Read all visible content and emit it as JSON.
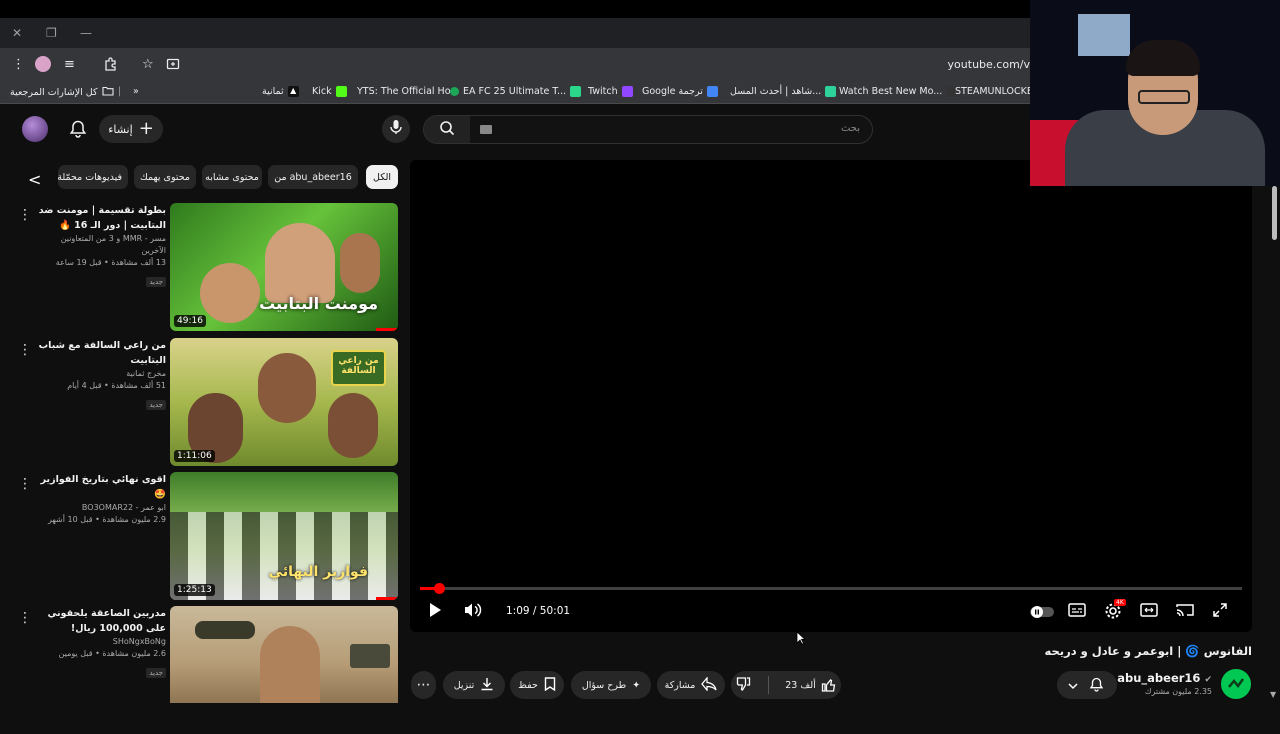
{
  "browser": {
    "url": "youtube.com/v",
    "bookmarks_all_label": "كل الإشارات المرجعية",
    "bookmarks": [
      {
        "label": "ثمانية",
        "color": "#000000"
      },
      {
        "label": "Kick",
        "color": "#53fc18"
      },
      {
        "label": "YTS: The Official Ho...",
        "color": "#444444"
      },
      {
        "label": "EA FC 25 Ultimate T...",
        "color": "#1ca858"
      },
      {
        "label": "Twitch",
        "color": "#9146ff"
      },
      {
        "label": "Google ترجمة",
        "color": "#4285f4"
      },
      {
        "label": "شاهد | أحدث المسل...",
        "color": "#2ed39c"
      },
      {
        "label": "Watch Best New Mo...",
        "color": "#333333"
      },
      {
        "label": "STEAMUNLOCKED",
        "color": "#666666"
      }
    ]
  },
  "header": {
    "create_label": "إنشاء",
    "search_placeholder": "بحث"
  },
  "chips": [
    "الكل",
    "من abu_abeer16",
    "محتوى مشابه",
    "محتوى يهمك",
    "فيديوهات محمّلة مؤخرًا"
  ],
  "recommendations": [
    {
      "title": "بطولة تقسيمة | مومنت ضد البتابيت | دور الـ 16 🔥",
      "channel": "مسر - MMR و 3 من المتعاونين الآخرين",
      "stats": "13 ألف مشاهدة • قبل 19 ساعة",
      "badge": "جديد",
      "duration": "49:16",
      "thumb_text": "مومنت البتابيت"
    },
    {
      "title": "من راعي السالفة مع شباب البتابيت",
      "channel": "مخرج ثمانية",
      "stats": "51 ألف مشاهدة • قبل 4 أيام",
      "badge": "جديد",
      "duration": "1:11:06",
      "thumb_text": "من راعي السالفة"
    },
    {
      "title": "اقوى نهائي بتاريخ الفوازير 🤩",
      "channel": "ابو عمر - BO3OMAR22",
      "stats": "2.9 مليون مشاهدة • قبل 10 أشهر",
      "badge": "",
      "duration": "1:25:13",
      "thumb_text": "فوازير النهائي"
    },
    {
      "title": "مدربين الصاعقة يلحقوني على 100,000 ريال!",
      "channel": "SHoNgxBoNg",
      "stats": "2.6 مليون مشاهدة • قبل يومين",
      "badge": "جديد",
      "duration": "",
      "thumb_text": ""
    }
  ],
  "player": {
    "current_time": "1:09",
    "total_time": "50:01",
    "time_display": "1:09 / 50:01",
    "progress_fraction": 0.023
  },
  "video": {
    "title": "الفانوس 🌀 | ابوعمر و عادل و دريحه",
    "channel_name": "abu_abeer16",
    "subscribers": "2.35 مليون مشترك",
    "like_count": "23 ألف",
    "share_label": "مشاركة",
    "ask_label": "طرح سؤال",
    "save_label": "حفظ",
    "download_label": "تنزيل"
  }
}
